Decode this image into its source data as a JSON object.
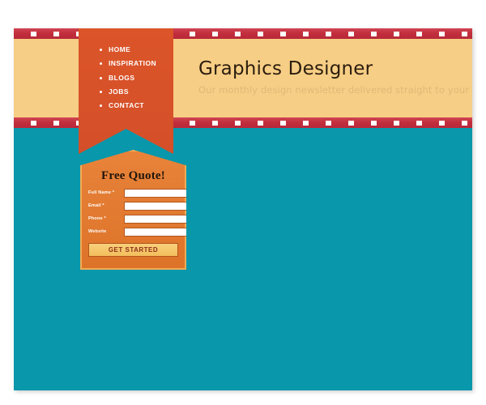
{
  "theme": {
    "teal": "#0897ab",
    "beige": "#f7ce85",
    "ribbon_orange": "#d9532c",
    "card_orange": "#e07a2f",
    "filmstrip_red": "#c9303f",
    "button_amber": "#f6c76c",
    "button_text": "#8e2d16"
  },
  "header": {
    "title": "Graphics Designer",
    "tagline": "Our monthly design newsletter delivered straight to your inbox"
  },
  "nav": {
    "items": [
      {
        "label": "HOME"
      },
      {
        "label": "INSPIRATION"
      },
      {
        "label": "BLOGS"
      },
      {
        "label": "JOBS"
      },
      {
        "label": "CONTACT"
      }
    ]
  },
  "quote_form": {
    "title": "Free Quote!",
    "fields": [
      {
        "label": "Full Name *",
        "value": "",
        "placeholder": ""
      },
      {
        "label": "Email *",
        "value": "",
        "placeholder": ""
      },
      {
        "label": "Phone *",
        "value": "",
        "placeholder": ""
      },
      {
        "label": "Website",
        "value": "",
        "placeholder": ""
      }
    ],
    "submit_label": "GET STARTED"
  }
}
